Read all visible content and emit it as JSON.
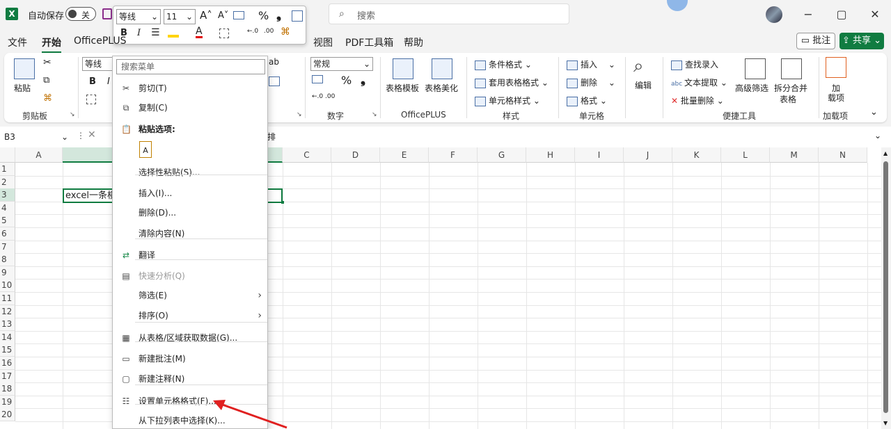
{
  "titlebar": {
    "autosave_label": "自动保存",
    "toggle_state": "关",
    "search_placeholder": "搜索",
    "win_minimize": "−",
    "win_restore": "▢",
    "win_close": "✕"
  },
  "menu": {
    "tabs": [
      "文件",
      "开始",
      "OfficePLUS",
      "视图",
      "PDF工具箱",
      "帮助"
    ],
    "active": "开始",
    "comment_label": "批注",
    "share_label": "共享"
  },
  "ribbon": {
    "clipboard": {
      "paste": "粘贴",
      "label": "剪贴板"
    },
    "font": {
      "name": "等线",
      "bold": "B",
      "italic": "I"
    },
    "number": {
      "format": "常规",
      "percent": "%",
      "comma": "❟",
      "label": "数字"
    },
    "officeplus": {
      "template": "表格模板",
      "beautify": "表格美化",
      "label": "OfficePLUS"
    },
    "styles": {
      "conditional": "条件格式",
      "table_format": "套用表格格式",
      "cell_style": "单元格样式",
      "label": "样式"
    },
    "cells": {
      "insert": "插入",
      "delete": "删除",
      "format": "格式",
      "label": "单元格"
    },
    "editing": {
      "edit": "编辑"
    },
    "tools": {
      "lookup": "查找录入",
      "text_extract": "文本提取",
      "batch_delete": "批量删除",
      "adv_filter": "高级筛选",
      "split_merge_1": "拆分合并",
      "split_merge_2": "表格",
      "label": "便捷工具"
    },
    "addins": {
      "add_1": "加",
      "add_2": "载项",
      "label": "加载项"
    }
  },
  "formula": {
    "namebox": "B3",
    "content": "排"
  },
  "mini_toolbar": {
    "font": "等线",
    "size": "11",
    "bold": "B",
    "italic": "I",
    "percent": "%"
  },
  "grid": {
    "columns": [
      "A",
      "B",
      "C",
      "D",
      "E",
      "F",
      "G",
      "H",
      "I",
      "J",
      "K",
      "L",
      "M",
      "N"
    ],
    "rows": [
      "1",
      "2",
      "3",
      "4",
      "5",
      "6",
      "7",
      "8",
      "9",
      "10",
      "11",
      "12",
      "13",
      "14",
      "15",
      "16",
      "17",
      "18",
      "19",
      "20"
    ],
    "cell_b3": "excel一条横"
  },
  "context_menu": {
    "search_placeholder": "搜索菜单",
    "items": [
      {
        "label": "剪切(T)",
        "icon": "scissors-icon"
      },
      {
        "label": "复制(C)",
        "icon": "copy-icon"
      },
      {
        "label": "粘贴选项:",
        "icon": "paste-icon"
      },
      {
        "label": "选择性粘贴(S)...",
        "icon": ""
      },
      {
        "label": "插入(I)...",
        "icon": ""
      },
      {
        "label": "删除(D)...",
        "icon": ""
      },
      {
        "label": "清除内容(N)",
        "icon": ""
      },
      {
        "label": "翻译",
        "icon": "translate-icon"
      },
      {
        "label": "快速分析(Q)",
        "icon": "quick-analysis-icon"
      },
      {
        "label": "筛选(E)",
        "icon": ""
      },
      {
        "label": "排序(O)",
        "icon": ""
      },
      {
        "label": "从表格/区域获取数据(G)...",
        "icon": "table-icon"
      },
      {
        "label": "新建批注(M)",
        "icon": "comment-icon"
      },
      {
        "label": "新建注释(N)",
        "icon": "note-icon"
      },
      {
        "label": "设置单元格格式(F)...",
        "icon": "format-cells-icon"
      },
      {
        "label": "从下拉列表中选择(K)...",
        "icon": ""
      }
    ]
  },
  "colors": {
    "accent": "#107c41",
    "arrow": "#e02020"
  }
}
